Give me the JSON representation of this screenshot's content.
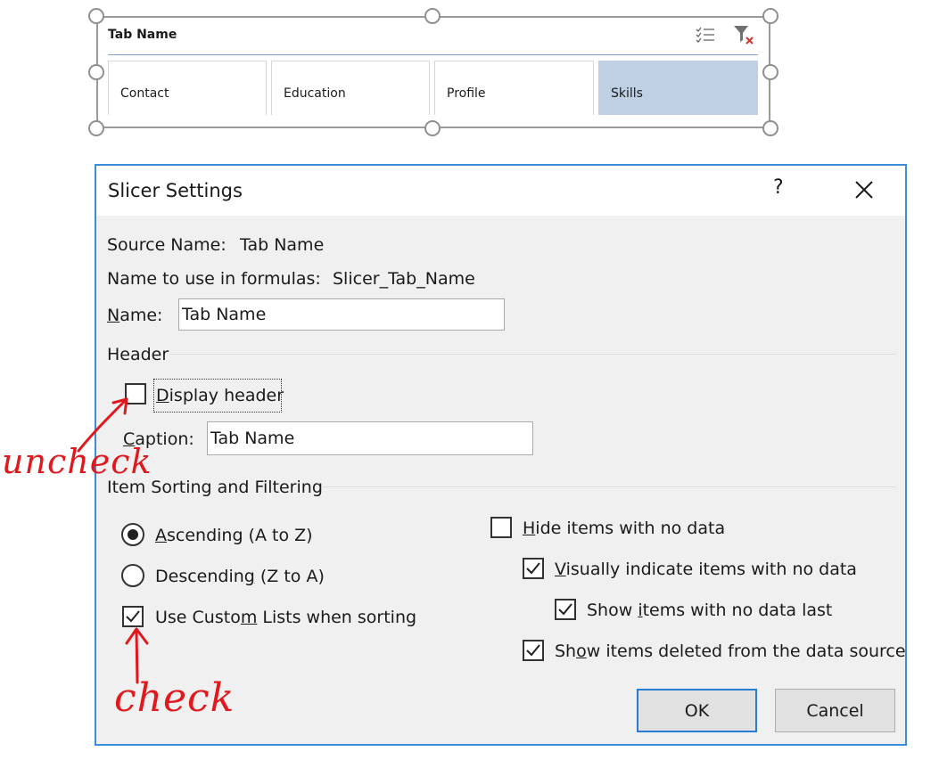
{
  "slicer": {
    "header": "Tab Name",
    "items": [
      {
        "label": "Contact",
        "selected": false
      },
      {
        "label": "Education",
        "selected": false
      },
      {
        "label": "Profile",
        "selected": false
      },
      {
        "label": "Skills",
        "selected": true
      }
    ],
    "icons": [
      "multi-select-icon",
      "clear-filter-icon"
    ],
    "selected_color": "#bfcfe4"
  },
  "dialog": {
    "title": "Slicer Settings",
    "help": "?",
    "source_name_label": "Source Name:",
    "source_name_value": "Tab Name",
    "formula_name_label": "Name to use in formulas:",
    "formula_name_value": "Slicer_Tab_Name",
    "name_label_first": "N",
    "name_label_rest": "ame:",
    "name_value": "Tab Name",
    "header_section": "Header",
    "display_header_first": "D",
    "display_header_rest": "isplay header",
    "display_header_checked": false,
    "caption_label_first": "C",
    "caption_label_rest": "aption:",
    "caption_value": "Tab Name",
    "sorting_section": "Item Sorting and Filtering",
    "ascending_first": "A",
    "ascending_rest": "scending (A to Z)",
    "ascending_selected": true,
    "descending_pre": "Descendin",
    "descending_u": "g",
    "descending_post": " (Z to A)",
    "custom_lists_pre": "Use Custo",
    "custom_lists_u": "m",
    "custom_lists_post": " Lists when sorting",
    "custom_lists_checked": true,
    "hide_items_first": "H",
    "hide_items_rest": "ide items with no data",
    "hide_items_checked": false,
    "visually_first": "V",
    "visually_rest": "isually indicate items with no data",
    "visually_checked": true,
    "show_last_pre": "Show ",
    "show_last_u": "i",
    "show_last_post": "tems with no data last",
    "show_last_checked": true,
    "show_deleted_pre": "Sh",
    "show_deleted_u": "o",
    "show_deleted_post": "w items deleted from the data source",
    "show_deleted_checked": true,
    "ok": "OK",
    "cancel": "Cancel",
    "accent": "#2a7bd4"
  },
  "annotations": {
    "uncheck": "uncheck",
    "check": "check",
    "color": "#e0191e"
  }
}
